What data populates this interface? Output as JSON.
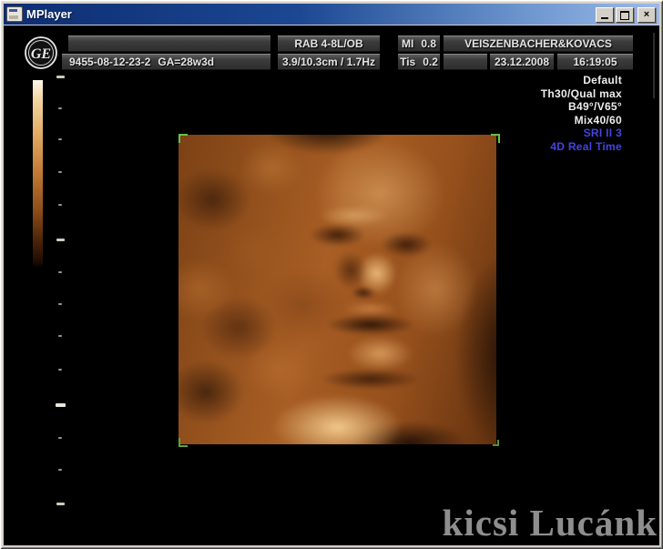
{
  "window": {
    "title": "MPlayer",
    "controls": {
      "close_glyph": "×"
    }
  },
  "ultrasound": {
    "logo": "GE",
    "header": {
      "probe": "RAB 4-8L/OB",
      "mi_label": "MI",
      "mi_value": "0.8",
      "facility": "VEISZENBACHER&KOVACS",
      "patient_id": "9455-08-12-23-2",
      "gestational_age": "GA=28w3d",
      "depth_zoom_freq": "3.9/10.3cm / 1.7Hz",
      "tis_label": "Tis",
      "tis_value": "0.2",
      "date": "23.12.2008",
      "time": "16:19:05"
    },
    "settings": {
      "lines": [
        {
          "label": "Default"
        },
        {
          "label": "Th30/Qual max"
        },
        {
          "label": "B49°/V65°"
        },
        {
          "label": "Mix40/60"
        },
        {
          "label": "SRI II 3"
        },
        {
          "label": "4D Real Time"
        }
      ]
    },
    "watermark": "kicsi Lucánk",
    "colors": {
      "accent_blue": "#4444e0",
      "header_text": "#e4e4e4",
      "watermark_gray": "#8e8e8e",
      "bracket_green": "#66c24a",
      "titlebar_left": "#0d2d72",
      "titlebar_right": "#9db9e8"
    }
  }
}
